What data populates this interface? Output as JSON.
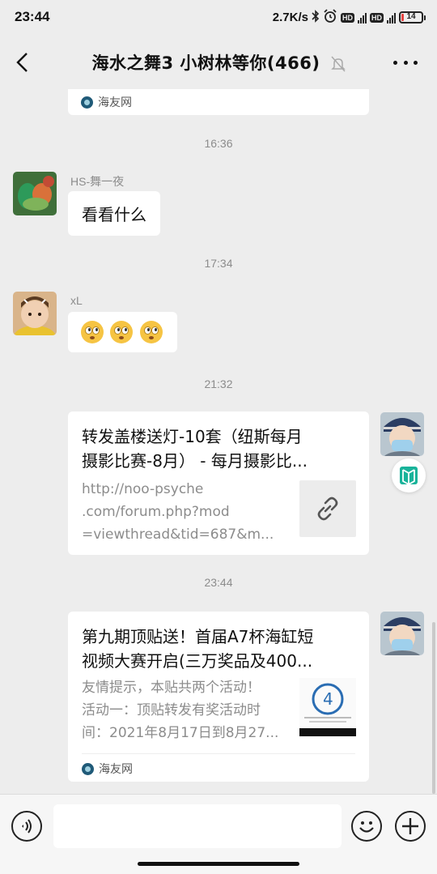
{
  "status_bar": {
    "time": "23:44",
    "net_speed": "2.7K/s",
    "battery": "14",
    "battery_level": 0.14,
    "icons": [
      "bluetooth-icon",
      "alarm-icon",
      "hd-icon",
      "signal-4g-icon",
      "hd-icon",
      "signal-4g-icon",
      "battery-icon"
    ]
  },
  "header": {
    "title": "海水之舞3 小树林等你(466)",
    "icons": [
      "back-icon",
      "mute-bell-icon",
      "more-icon"
    ]
  },
  "messages": {
    "top_card": {
      "source": "海友网"
    },
    "ts1": "16:36",
    "m1": {
      "sender": "HS-舞一夜",
      "text": "看看什么"
    },
    "ts2": "17:34",
    "m2": {
      "sender": "xL",
      "emoji": [
        "rolling-eyes-emoji",
        "rolling-eyes-emoji",
        "rolling-eyes-emoji"
      ]
    },
    "ts3": "21:32",
    "m3": {
      "title_line1": "转发盖楼送灯-10套（纽斯每月",
      "title_line2": "摄影比赛-8月） - 每月摄影比...",
      "desc_line1": "http://noo-psyche",
      "desc_line2": ".com/forum.php?mod",
      "desc_line3": "=viewthread&tid=687&m...",
      "thumb_icon": "link-icon"
    },
    "ts4": "23:44",
    "m4": {
      "title_line1": "第九期顶贴送！首届A7杯海缸短",
      "title_line2": "视频大赛开启(三万奖品及400...",
      "desc_line1": "友情提示，本贴共两个活动！",
      "desc_line2": "活动一：顶贴转发有奖活动时",
      "desc_line3": "间：2021年8月17日到8月27...",
      "source": "海友网"
    }
  },
  "floating_tool": {
    "icon": "mini-program-icon"
  },
  "bottom_bar": {
    "input_value": "",
    "icons": [
      "voice-icon",
      "emoji-icon",
      "plus-icon"
    ]
  }
}
